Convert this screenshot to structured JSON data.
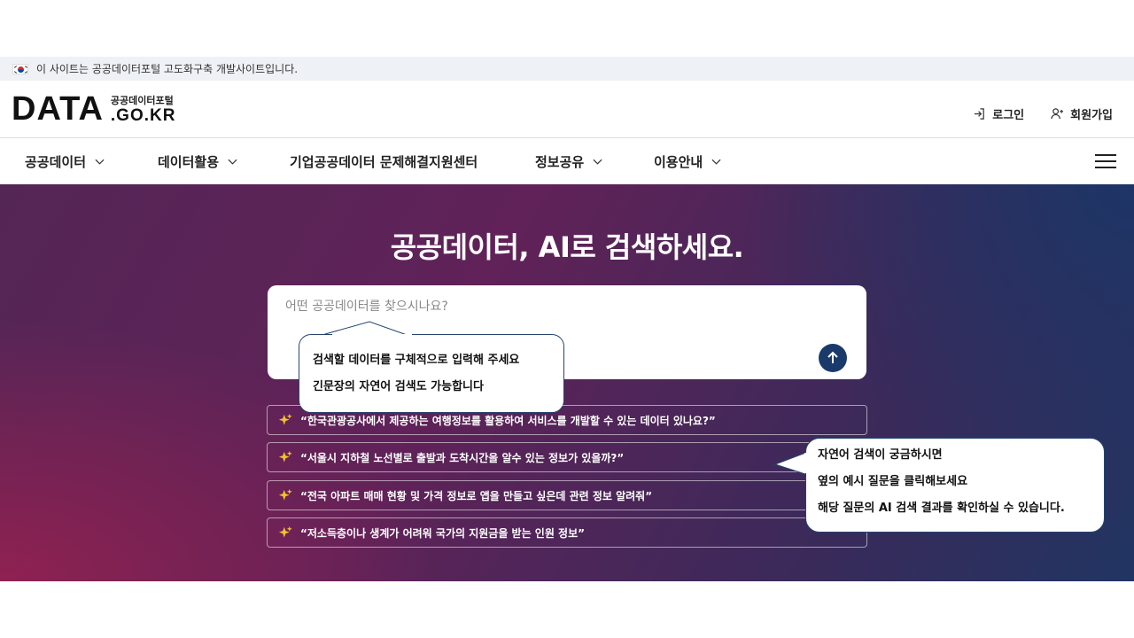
{
  "notice": {
    "text": "이 사이트는 공공데이터포털 고도화구축 개발사이트입니다."
  },
  "header": {
    "logo_main": "DATA",
    "logo_kor": "공공데이터포털",
    "logo_eng": ".GO.KR",
    "login_label": "로그인",
    "signup_label": "회원가입"
  },
  "gnb": {
    "items": [
      {
        "label": "공공데이터",
        "has_dropdown": true
      },
      {
        "label": "데이터활용",
        "has_dropdown": true
      },
      {
        "label": "기업공공데이터 문제해결지원센터",
        "has_dropdown": false
      },
      {
        "label": "정보공유",
        "has_dropdown": true
      },
      {
        "label": "이용안내",
        "has_dropdown": true
      }
    ]
  },
  "hero": {
    "title": "공공데이터, AI로 검색하세요.",
    "search_placeholder": "어떤 공공데이터를 찾으시나요?",
    "callout": {
      "line1": "검색할 데이터를 구체적으로 입력해 주세요",
      "line2": "긴문장의 자연어 검색도 가능합니다"
    },
    "examples": [
      "“한국관광공사에서 제공하는 여행정보를 활용하여 서비스를 개발할 수 있는 데이터 있나요?”",
      "“서울시 지하철 노선별로 출발과 도착시간을 알수 있는 정보가 있을까?”",
      "“전국 아파트 매매 현황 및 가격 정보로 앱을 만들고 싶은데 관련 정보 알려줘”",
      "“저소득층이나 생계가 어려워 국가의 지원금을 받는 인원 정보”"
    ],
    "side_callout": {
      "line1": "자연어 검색이 궁금하시면",
      "line2": "옆의 예시 질문을 클릭해보세요",
      "line3": "해당 질문의 AI 검색 결과를 확인하실 수 있습니다."
    }
  },
  "colors": {
    "brand_navy": "#1a3a6a",
    "spark_gold": "#f2c230",
    "hero_magenta": "#8f2151",
    "hero_navy": "#1d3566"
  }
}
